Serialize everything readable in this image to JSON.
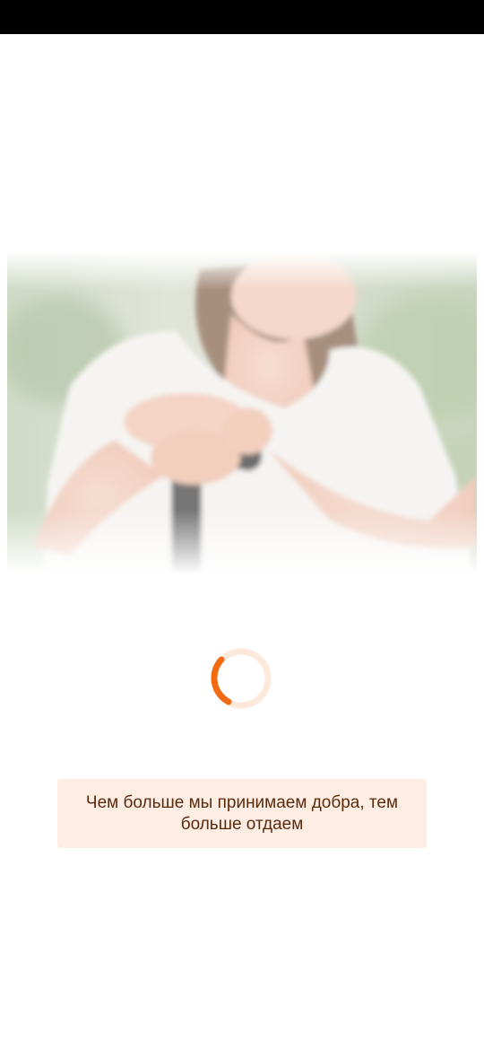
{
  "status_bar": {
    "color": "#000000"
  },
  "hero": {
    "image": "woman-hands-on-cane-photo"
  },
  "spinner": {
    "icon": "loading-spinner-icon",
    "accent_color": "#f26a13",
    "track_color": "#fde8dc",
    "progress": 0.25
  },
  "quote": {
    "text": "Чем больше мы принимаем добра, тем больше отдаем",
    "background_color": "#fdede3",
    "text_color": "#5a2a0e"
  }
}
